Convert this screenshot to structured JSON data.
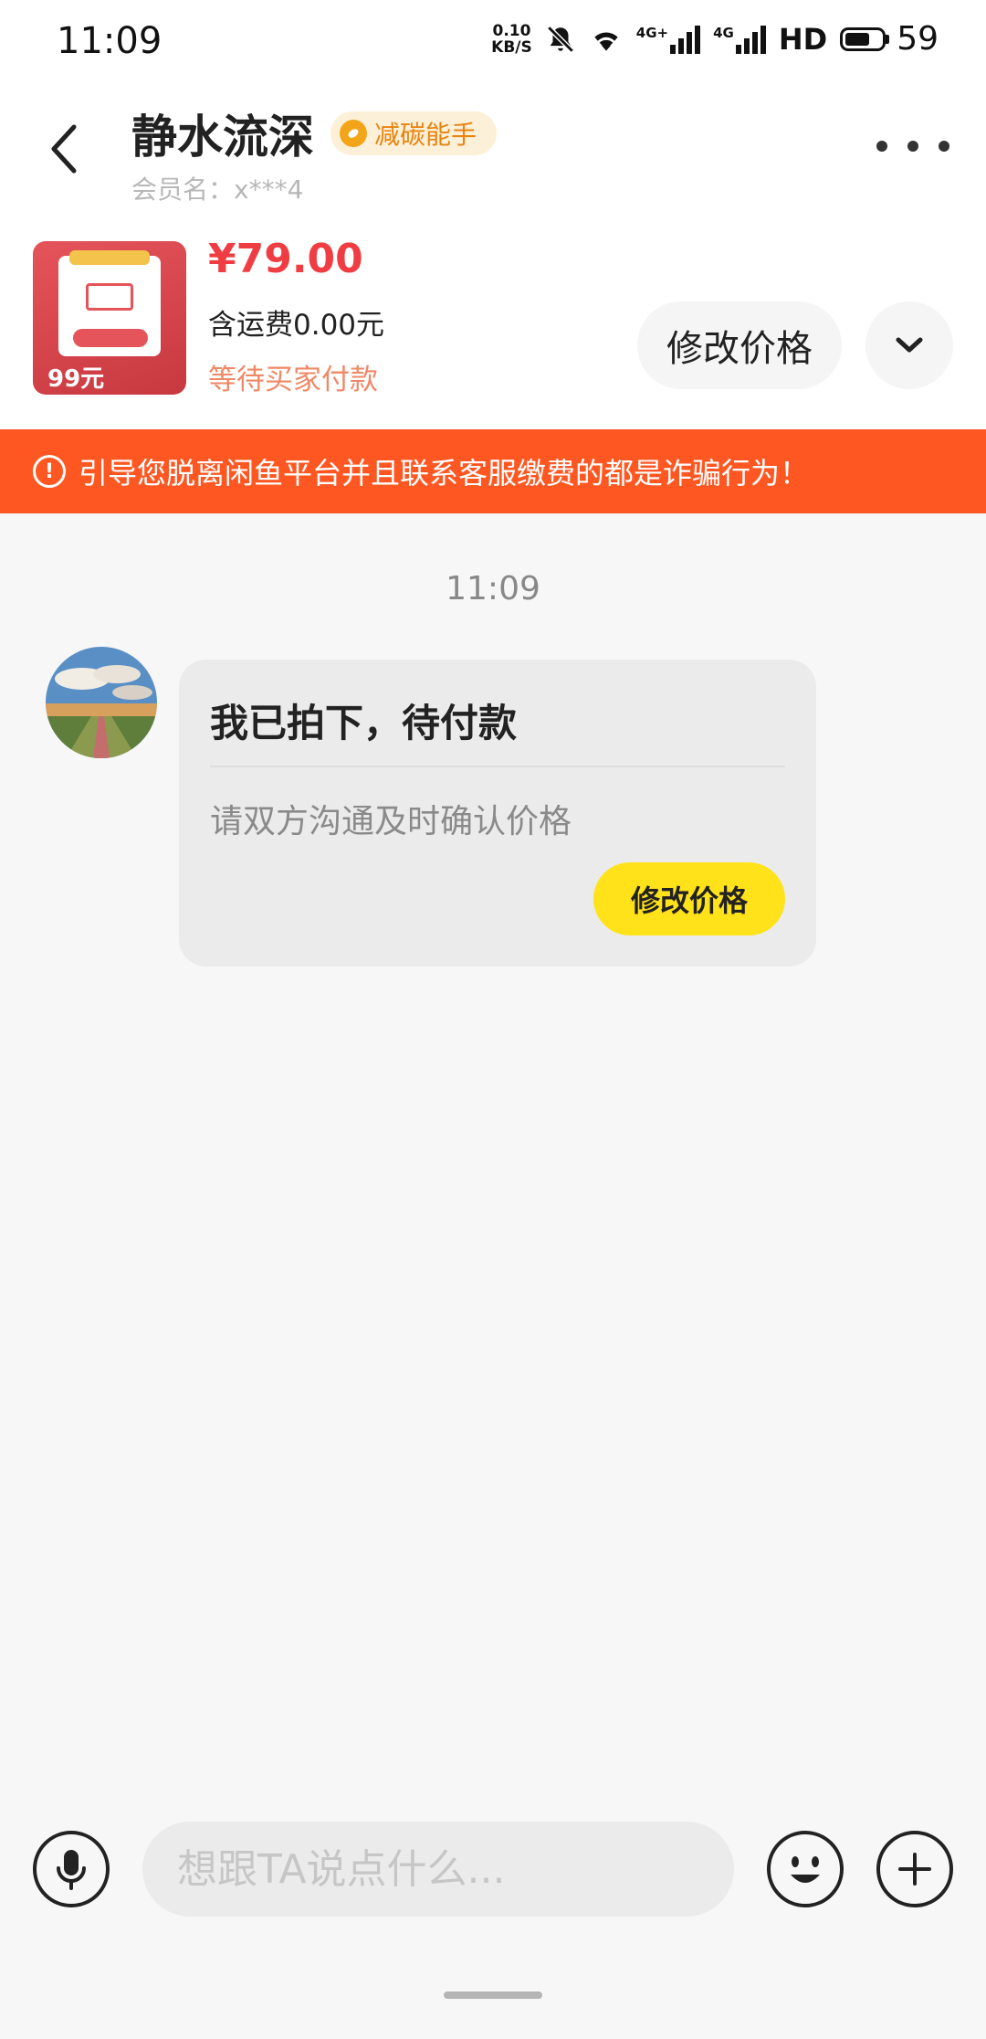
{
  "status_bar": {
    "time": "11:09",
    "net_speed_value": "0.10",
    "net_speed_unit": "KB/S",
    "signal_1_label": "4G+",
    "signal_2_label": "4G",
    "hd_label": "HD",
    "battery": "59",
    "icons": [
      "mute-icon",
      "wifi-icon",
      "signal-icon",
      "signal-icon",
      "battery-icon"
    ]
  },
  "header": {
    "name": "静水流深",
    "badge": "减碳能手",
    "member": "会员名：x***4"
  },
  "product": {
    "price": "¥79.00",
    "shipping": "含运费0.00元",
    "status": "等待买家付款",
    "modify_label": "修改价格",
    "thumb_text": "99元"
  },
  "warning": {
    "text": "引导您脱离闲鱼平台并且联系客服缴费的都是诈骗行为！"
  },
  "chat": {
    "time": "11:09",
    "message": {
      "title": "我已拍下，待付款",
      "subtitle": "请双方沟通及时确认价格",
      "button": "修改价格"
    }
  },
  "input": {
    "placeholder": "想跟TA说点什么..."
  },
  "colors": {
    "accent_red": "#ef3d43",
    "warning_orange": "#ff5722",
    "button_yellow": "#ffe219",
    "status_pink": "#f08866"
  }
}
